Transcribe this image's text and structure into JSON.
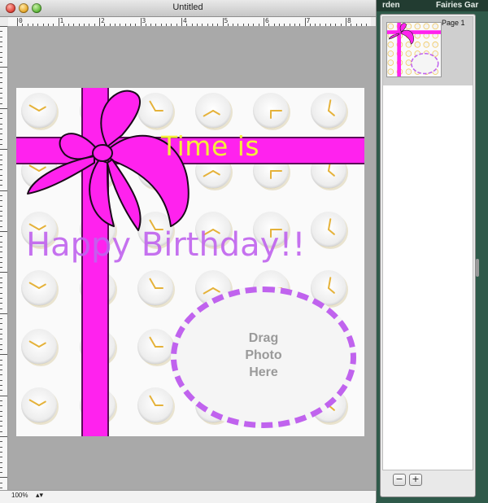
{
  "window": {
    "title": "Untitled"
  },
  "background_app": {
    "title_left": "rden",
    "title_right": "Fairies Gar"
  },
  "ruler": {
    "labels": [
      "0",
      "1",
      "2",
      "3",
      "4",
      "5",
      "6",
      "7",
      "8"
    ]
  },
  "card": {
    "headline": "Time is",
    "greeting": "Happy Birthday!!",
    "photo_placeholder_lines": [
      "Drag",
      "Photo",
      "Here"
    ]
  },
  "statusbar": {
    "zoom": "100%",
    "zoom_arrows": "▴▾"
  },
  "drawer": {
    "pages": [
      {
        "label": "Page 1"
      }
    ],
    "remove_label": "−",
    "add_label": "+"
  },
  "colors": {
    "ribbon": "#ff22ee",
    "greeting": "#c063ee",
    "headline": "#f5ee3a",
    "clock_rim": "#f2c95e"
  }
}
